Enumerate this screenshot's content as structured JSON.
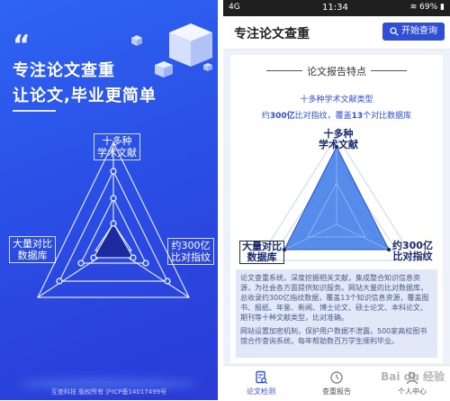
{
  "left_panel": {
    "quote_mark": "“",
    "slogan_line1": "专注论文查重",
    "slogan_line2": "让论文,毕业更简单",
    "radar_labels": {
      "top_line1": "十多种",
      "top_line2": "学术文献",
      "left_line1": "大量对比",
      "left_line2": "数据库",
      "right_line1": "约300亿",
      "right_line2": "比对指纹"
    },
    "footer": "互查科技  版权所有  沪ICP备14017499号"
  },
  "status_bar": {
    "signal": "4G",
    "time": "11:34",
    "battery": "69%"
  },
  "app_bar": {
    "title": "专注论文查重",
    "start_button": "开始查询"
  },
  "report": {
    "section_title": "论文报告特点",
    "feature1": "十多种学术文献类型",
    "feature2_prefix": "约",
    "feature2_num1": "300亿",
    "feature2_mid": "比对指纹，覆盖",
    "feature2_num2": "13",
    "feature2_suffix": "个对比数据库",
    "radar_labels": {
      "top_line1": "十多种",
      "top_line2": "学术文献",
      "left_line1": "大量对比",
      "left_line2": "数据库",
      "right_line1": "约300亿",
      "right_line2": "比对指纹"
    },
    "description_p1": "论文查重系统，深度挖掘相关文献，集成整合知识信息资源，为社会各方面提供知识服务。网站大量的比对数据库，总收录约300亿指纹数据，覆盖13个知识信息资源，覆盖图书、报纸、年鉴、新闻、博士论文、硕士论文、本科论文、期刊等十种文献类型，比对准确。",
    "description_p2": "网站设置加密机制，保护用户数据不泄露。500家高校图书馆合作查询系统，每年帮助数百万学生顺利毕业。"
  },
  "tabs": [
    {
      "label": "论文检测",
      "icon": "document-search-icon",
      "active": true
    },
    {
      "label": "查重报告",
      "icon": "clock-report-icon",
      "active": false
    },
    {
      "label": "个人中心",
      "icon": "person-icon",
      "active": false
    }
  ],
  "watermark": "Bai du 经验",
  "colors": {
    "brand_blue": "#2f4fd8",
    "panel_gradient_start": "#2f64f2",
    "panel_gradient_end": "#2a3bd6",
    "radar_fill": "#3a78e8"
  }
}
